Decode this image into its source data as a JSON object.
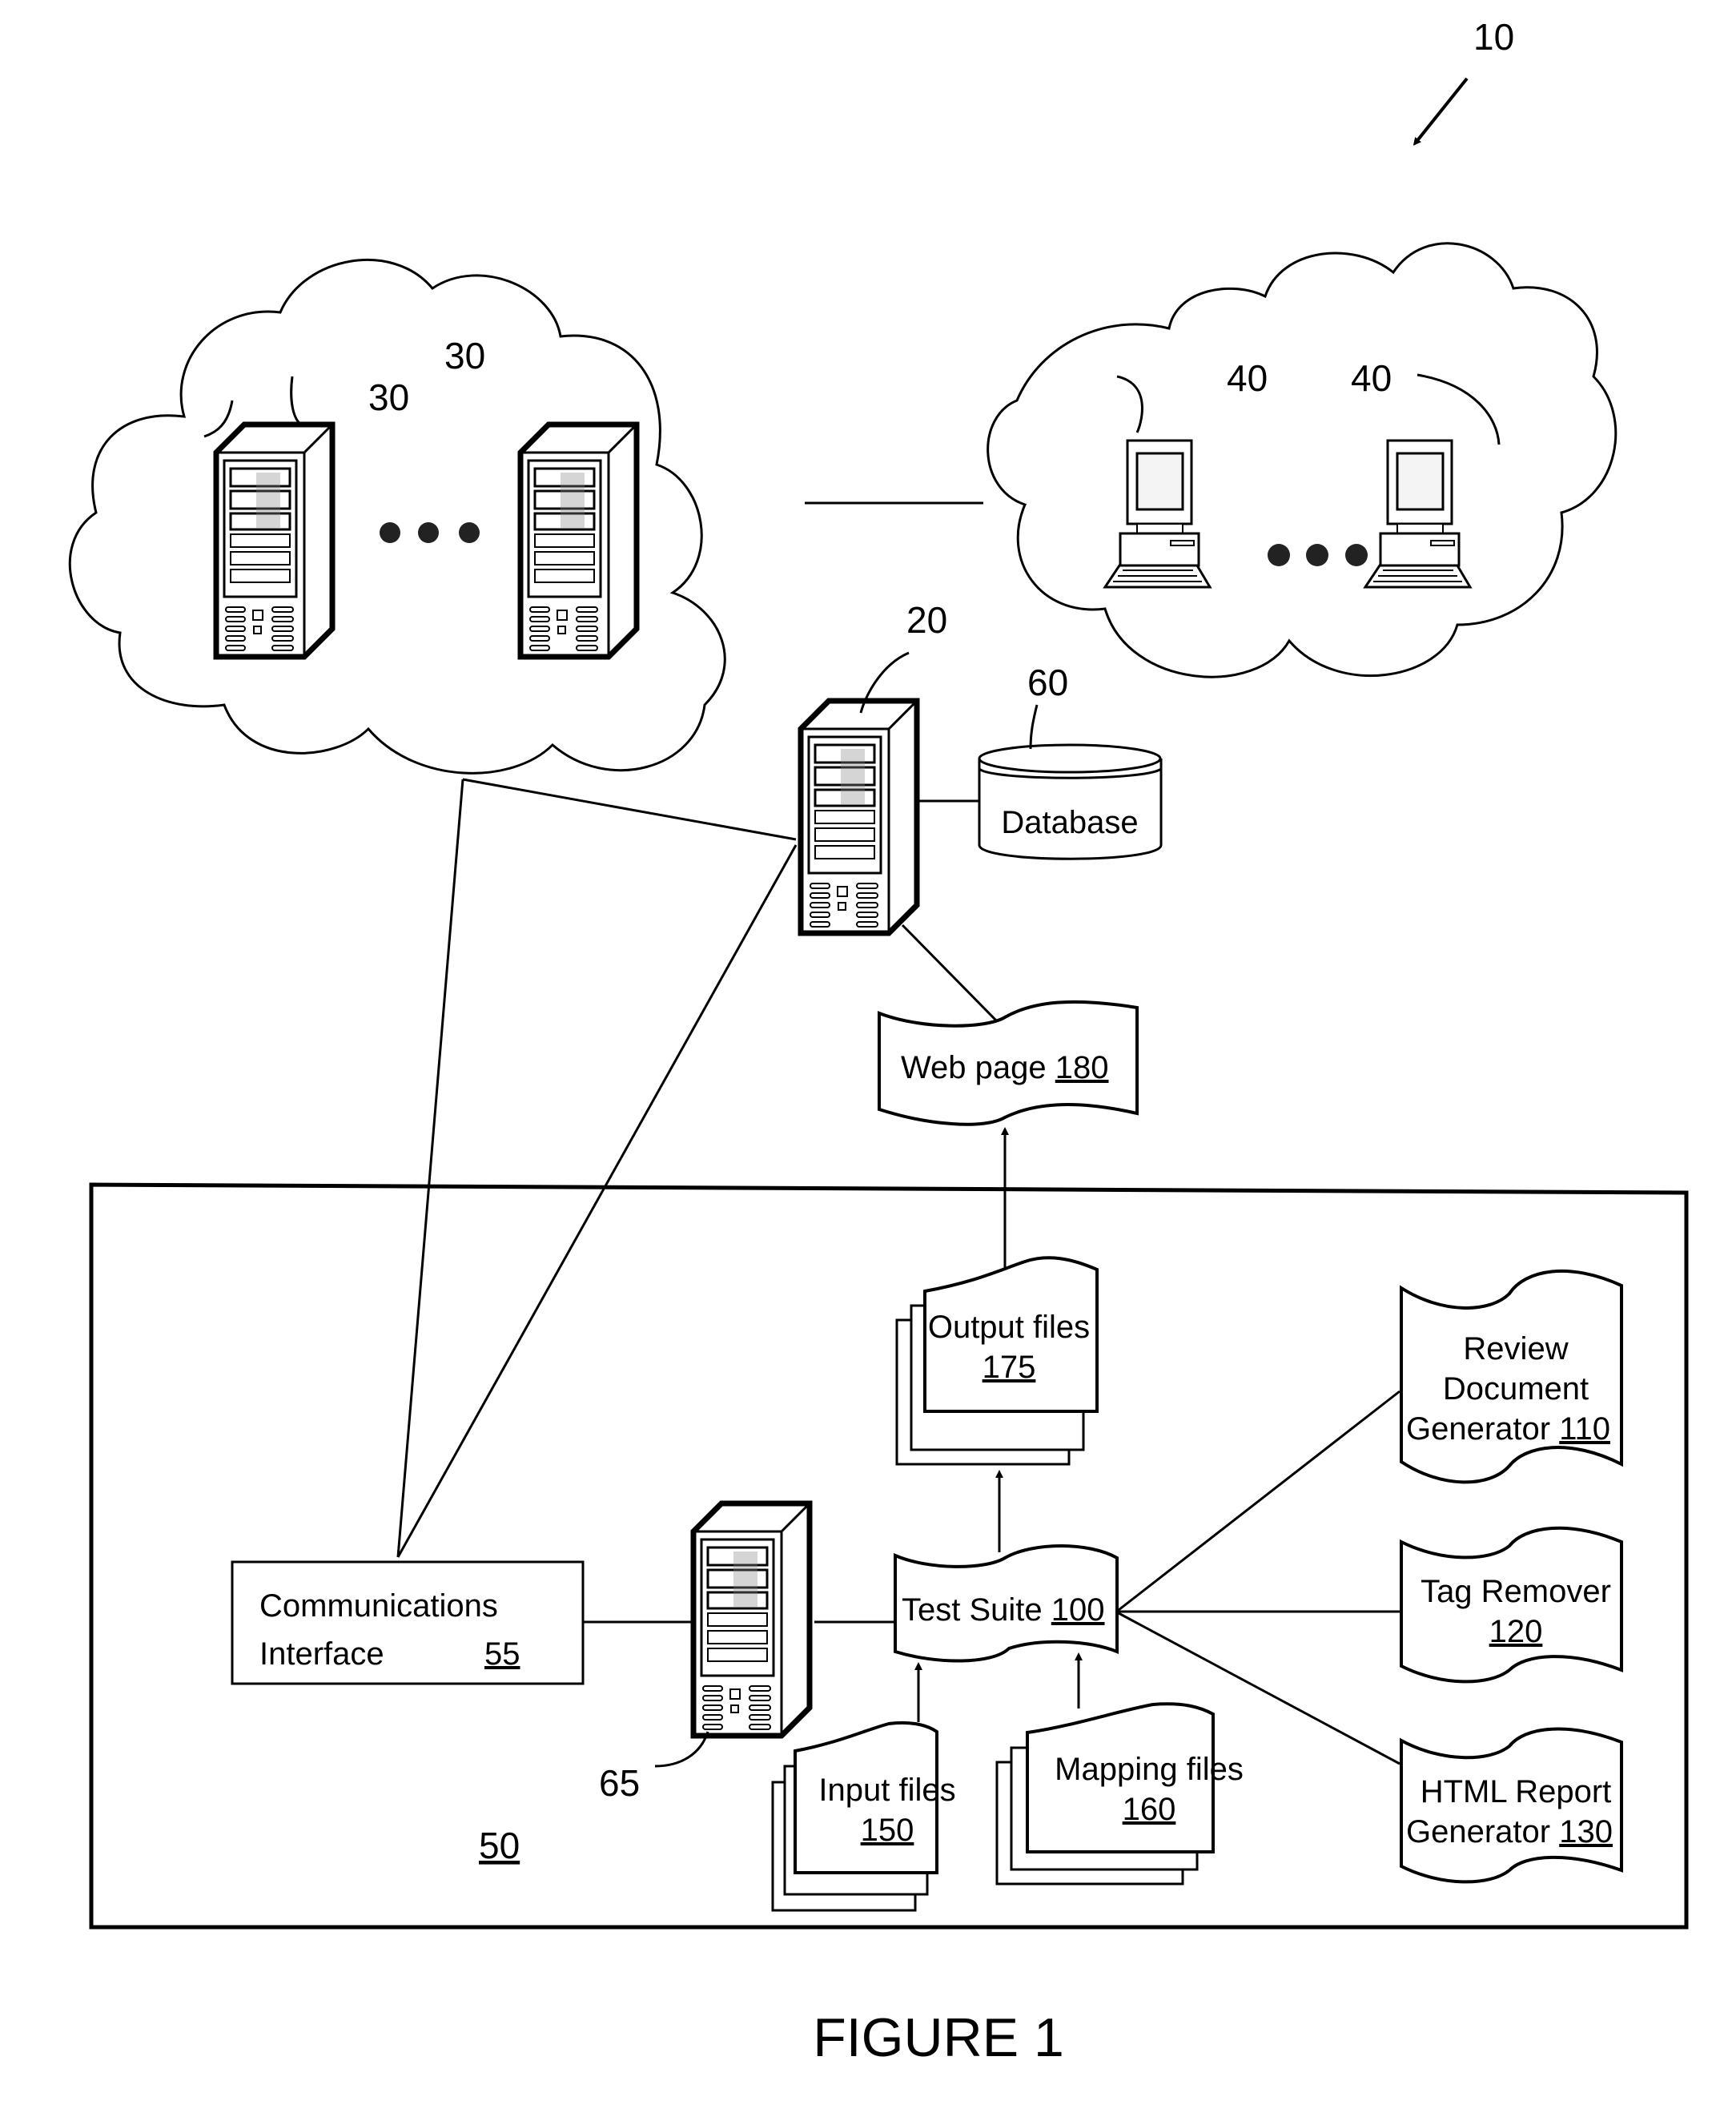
{
  "figure": {
    "caption": "FIGURE 1",
    "system_ref": "10"
  },
  "clouds": {
    "server_cloud": {
      "server_refs": [
        "30",
        "30"
      ],
      "ellipsis": "•••"
    },
    "client_cloud": {
      "client_refs": [
        "40",
        "40"
      ],
      "ellipsis": "•••"
    }
  },
  "web_server": {
    "ref": "20"
  },
  "database": {
    "ref": "60",
    "label": "Database"
  },
  "web_page": {
    "label": "Web page ",
    "ref": "180"
  },
  "system_box": {
    "ref": "50"
  },
  "comm_interface": {
    "line1": "Communications",
    "line2": "Interface",
    "ref": "55"
  },
  "local_server": {
    "ref": "65"
  },
  "test_suite": {
    "label": "Test Suite ",
    "ref": "100"
  },
  "output_files": {
    "label": "Output files",
    "ref": "175"
  },
  "input_files": {
    "label": "Input files",
    "ref": "150"
  },
  "mapping_files": {
    "label": "Mapping files",
    "ref": "160"
  },
  "review_doc_gen": {
    "line1": "Review",
    "line2": "Document",
    "line3": "Generator ",
    "ref": "110"
  },
  "tag_remover": {
    "line1": "Tag Remover",
    "ref": "120"
  },
  "html_report_gen": {
    "line1": "HTML Report",
    "line2": "Generator ",
    "ref": "130"
  }
}
